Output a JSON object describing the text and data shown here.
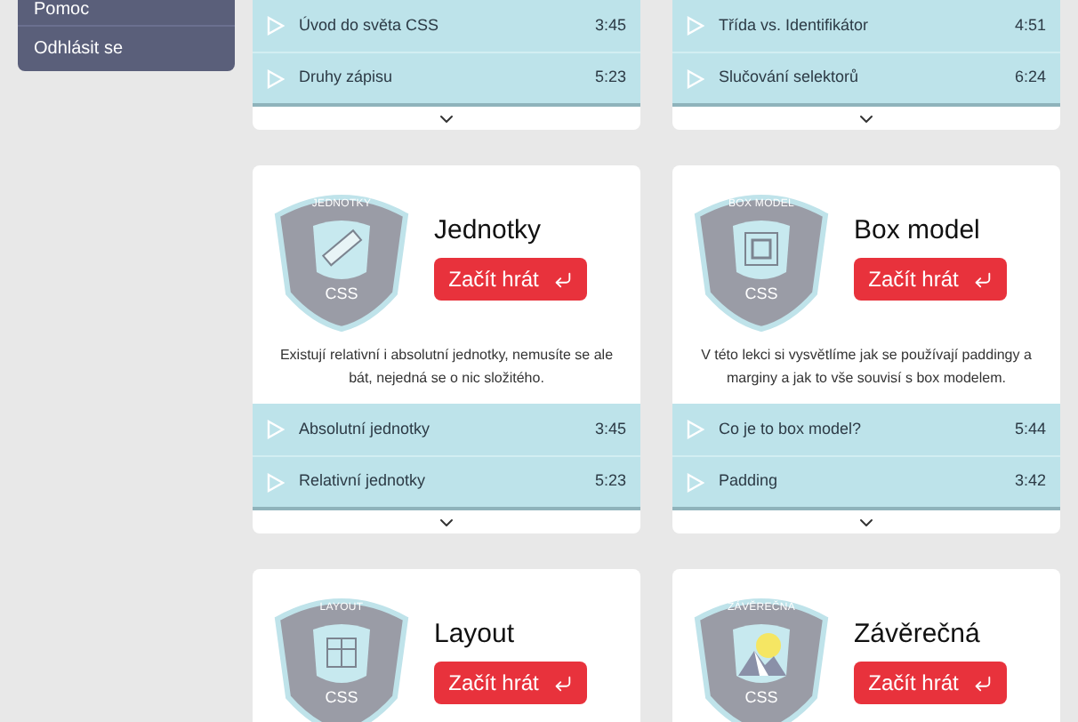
{
  "sidebar": {
    "items": [
      {
        "label": "Pomoc"
      },
      {
        "label": "Odhlásit se"
      }
    ]
  },
  "courses": [
    {
      "lessons": [
        {
          "title": "Úvod do světa CSS",
          "duration": "3:45"
        },
        {
          "title": "Druhy zápisu",
          "duration": "5:23"
        }
      ]
    },
    {
      "lessons": [
        {
          "title": "Třída vs. Identifikátor",
          "duration": "4:51"
        },
        {
          "title": "Slučování selektorů",
          "duration": "6:24"
        }
      ]
    },
    {
      "title": "Jednotky",
      "badge": {
        "label": "JEDNOTKY",
        "kind": "ruler",
        "footer": "CSS"
      },
      "button": "Začít hrát",
      "description": "Existují relativní i absolutní jednotky, nemusíte se ale bát, nejedná se o nic složitého.",
      "lessons": [
        {
          "title": "Absolutní jednotky",
          "duration": "3:45"
        },
        {
          "title": "Relativní jednotky",
          "duration": "5:23"
        }
      ]
    },
    {
      "title": "Box model",
      "badge": {
        "label": "BOX MODEL",
        "kind": "box",
        "footer": "CSS"
      },
      "button": "Začít hrát",
      "description": "V této lekci si vysvětlíme jak se používají paddingy a marginy a jak to vše souvisí s box modelem.",
      "lessons": [
        {
          "title": "Co je to box model?",
          "duration": "5:44"
        },
        {
          "title": "Padding",
          "duration": "3:42"
        }
      ]
    },
    {
      "title": "Layout",
      "badge": {
        "label": "LAYOUT",
        "kind": "layout",
        "footer": "CSS"
      },
      "button": "Začít hrát"
    },
    {
      "title": "Závěrečná",
      "badge": {
        "label": "ZÁVĚREČNÁ",
        "kind": "landscape",
        "footer": "CSS"
      },
      "button": "Začít hrát"
    }
  ]
}
